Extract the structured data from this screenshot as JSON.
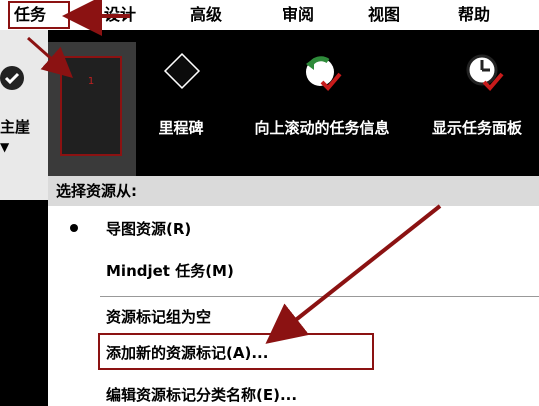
{
  "tabs": {
    "active": "任务",
    "items": [
      "设计",
      "高级",
      "审阅",
      "视图",
      "帮助"
    ]
  },
  "ribbon": {
    "left_partial_label": "主崖",
    "selected_group_number": "1",
    "buttons": [
      {
        "label": "里程碑",
        "icon": "milestone-diamond-icon"
      },
      {
        "label": "向上滚动的任务信息",
        "icon": "scroll-up-task-icon"
      },
      {
        "label": "显示任务面板",
        "icon": "task-panel-clock-icon"
      }
    ]
  },
  "menu": {
    "header": "选择资源从:",
    "items": [
      {
        "label": "导图资源(R)",
        "checked": true
      },
      {
        "label": "Mindjet 任务(M)",
        "checked": false
      }
    ],
    "actions": [
      "资源标记组为空",
      "添加新的资源标记(A)...",
      "编辑资源标记分类名称(E)..."
    ]
  },
  "colors": {
    "annotation_red": "#8b1212",
    "ribbon_bg": "#000000",
    "menu_bg": "#ffffff"
  }
}
